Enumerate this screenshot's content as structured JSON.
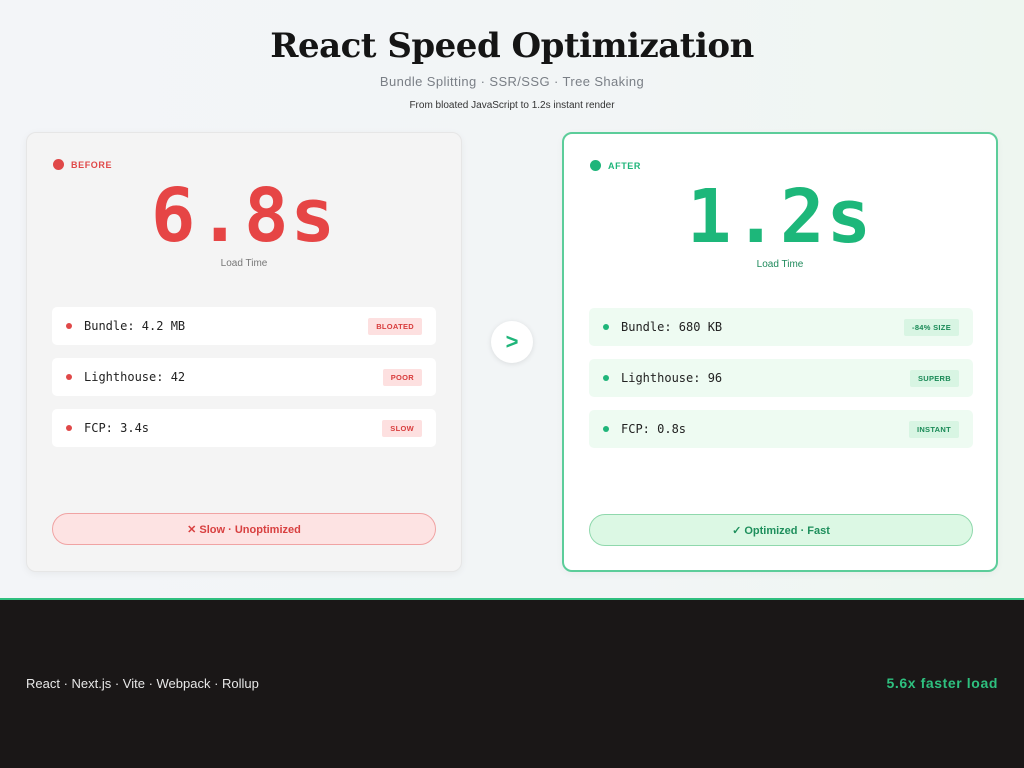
{
  "header": {
    "title": "React Speed Optimization",
    "subtitle": "Bundle Splitting · SSR/SSG · Tree Shaking",
    "tagline": "From bloated JavaScript to 1.2s instant render"
  },
  "before": {
    "label": "BEFORE",
    "time": "6.8s",
    "time_label": "Load Time",
    "rows": [
      {
        "text": "Bundle: 4.2 MB",
        "badge": "BLOATED"
      },
      {
        "text": "Lighthouse: 42",
        "badge": "POOR"
      },
      {
        "text": "FCP: 3.4s",
        "badge": "SLOW"
      }
    ],
    "status": "✕ Slow · Unoptimized"
  },
  "after": {
    "label": "AFTER",
    "time": "1.2s",
    "time_label": "Load Time",
    "rows": [
      {
        "text": "Bundle: 680 KB",
        "badge": "-84% SIZE"
      },
      {
        "text": "Lighthouse: 96",
        "badge": "SUPERB"
      },
      {
        "text": "FCP: 0.8s",
        "badge": "INSTANT"
      }
    ],
    "status": "✓ Optimized · Fast"
  },
  "arrow": ">",
  "footer": {
    "stack": "React · Next.js · Vite · Webpack · Rollup",
    "faster": "5.6x faster load"
  },
  "colors": {
    "before_accent": "#e64545",
    "after_accent": "#1db77a",
    "footer_bg": "#1a1717"
  }
}
